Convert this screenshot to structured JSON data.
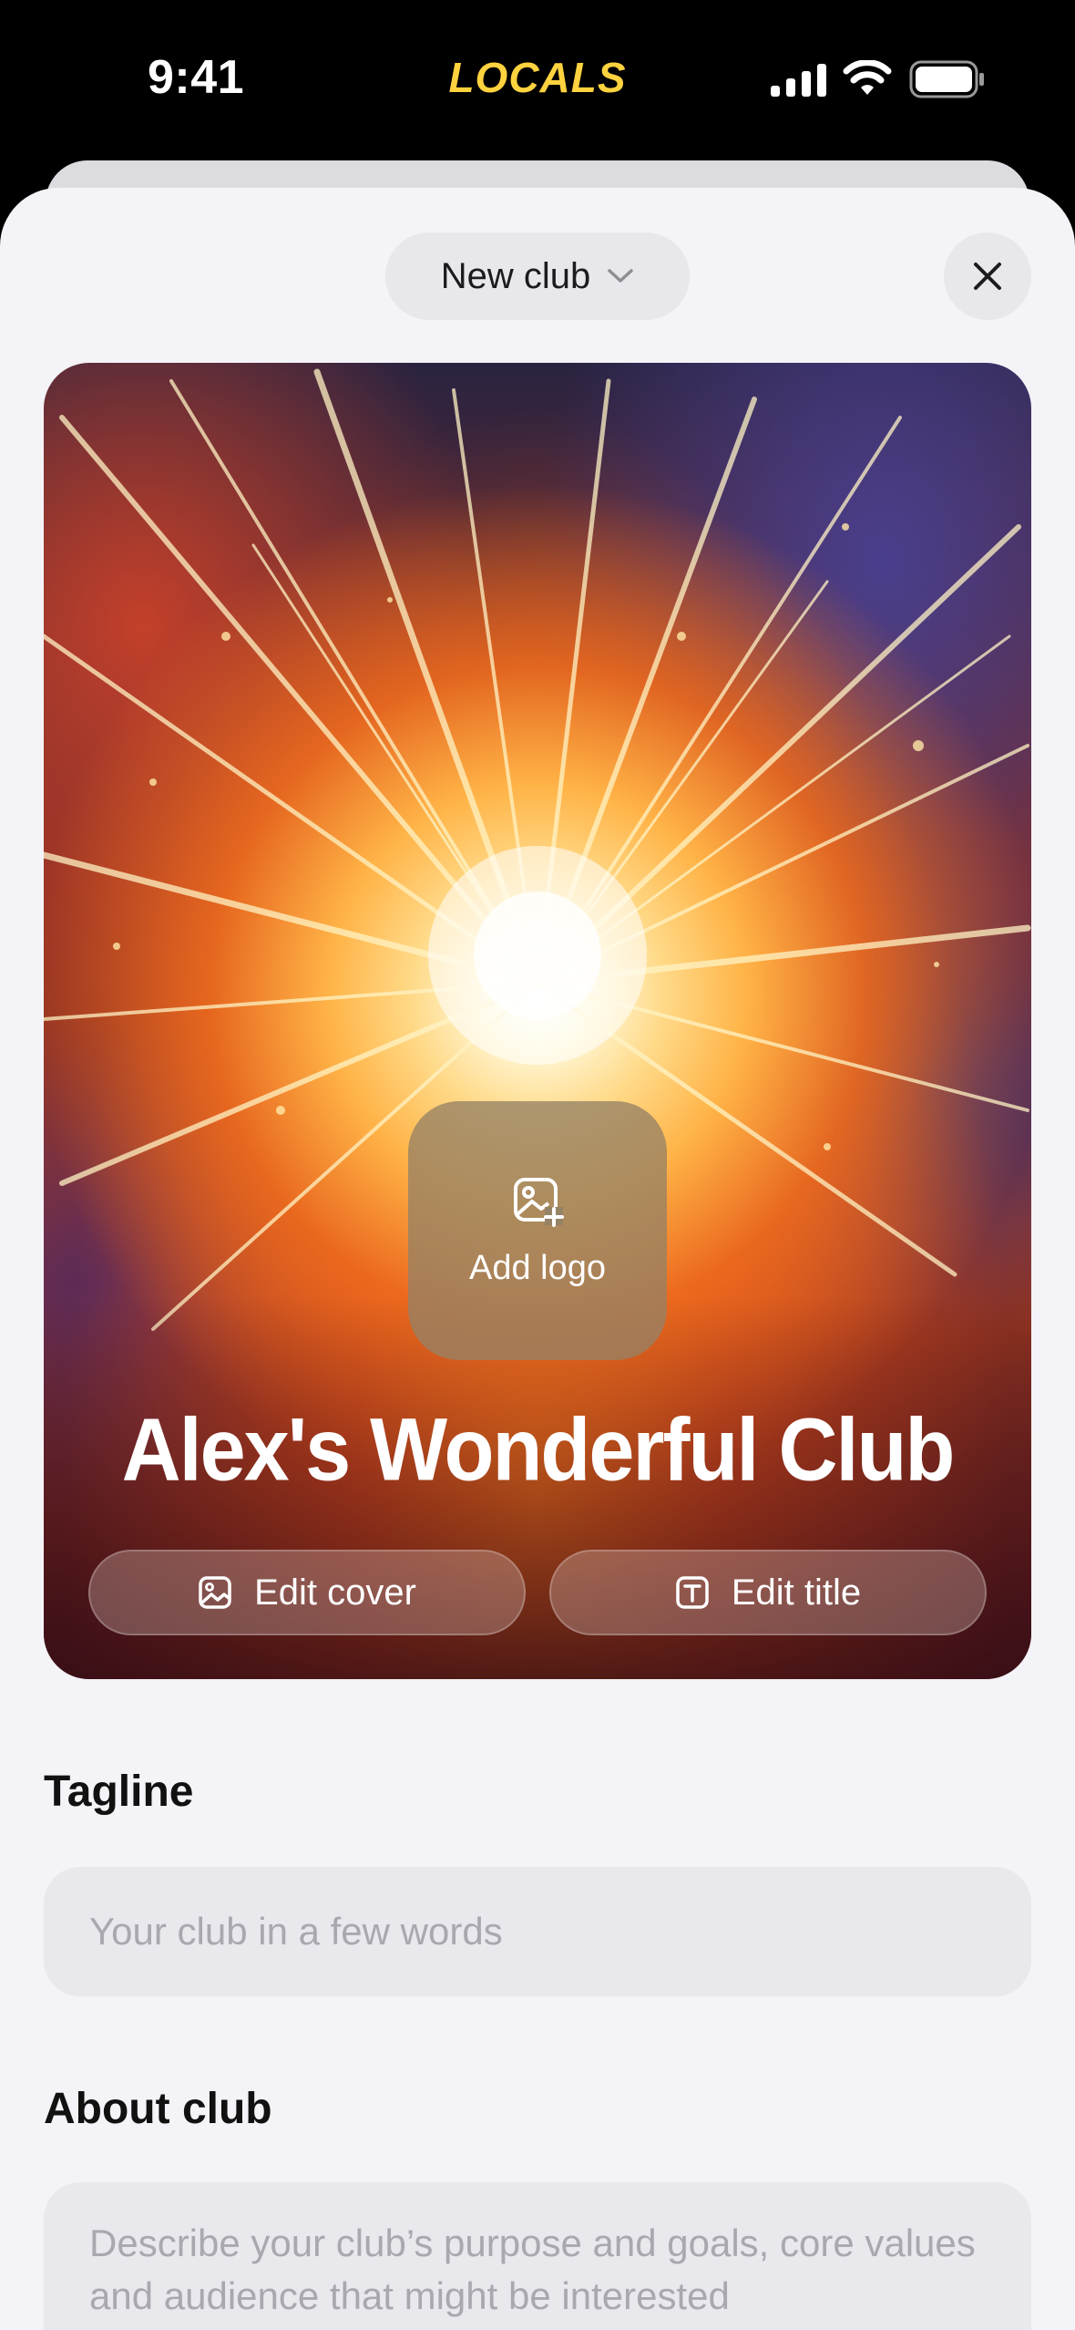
{
  "status_bar": {
    "time": "9:41",
    "brand": "LOCALS",
    "icons": [
      "signal-icon",
      "wifi-icon",
      "battery-icon"
    ]
  },
  "header": {
    "dropdown_label": "New club",
    "dropdown_icon": "chevron-down-icon",
    "close_icon": "close-icon"
  },
  "cover": {
    "add_logo_label": "Add logo",
    "add_logo_icon": "add-image-icon",
    "club_title": "Alex's Wonderful Club",
    "edit_cover_label": "Edit cover",
    "edit_cover_icon": "image-icon",
    "edit_title_label": "Edit title",
    "edit_title_icon": "text-icon"
  },
  "form": {
    "tagline": {
      "label": "Tagline",
      "value": "",
      "placeholder": "Your club in a few words"
    },
    "about": {
      "label": "About club",
      "value": "",
      "placeholder": "Describe your club’s purpose and goals, core values and audience that might be interested"
    }
  },
  "colors": {
    "brand": "#FFD23F",
    "sheet_background": "#F4F3F7",
    "field_background": "#E9E8ED",
    "placeholder_text": "#A9A8AE"
  }
}
